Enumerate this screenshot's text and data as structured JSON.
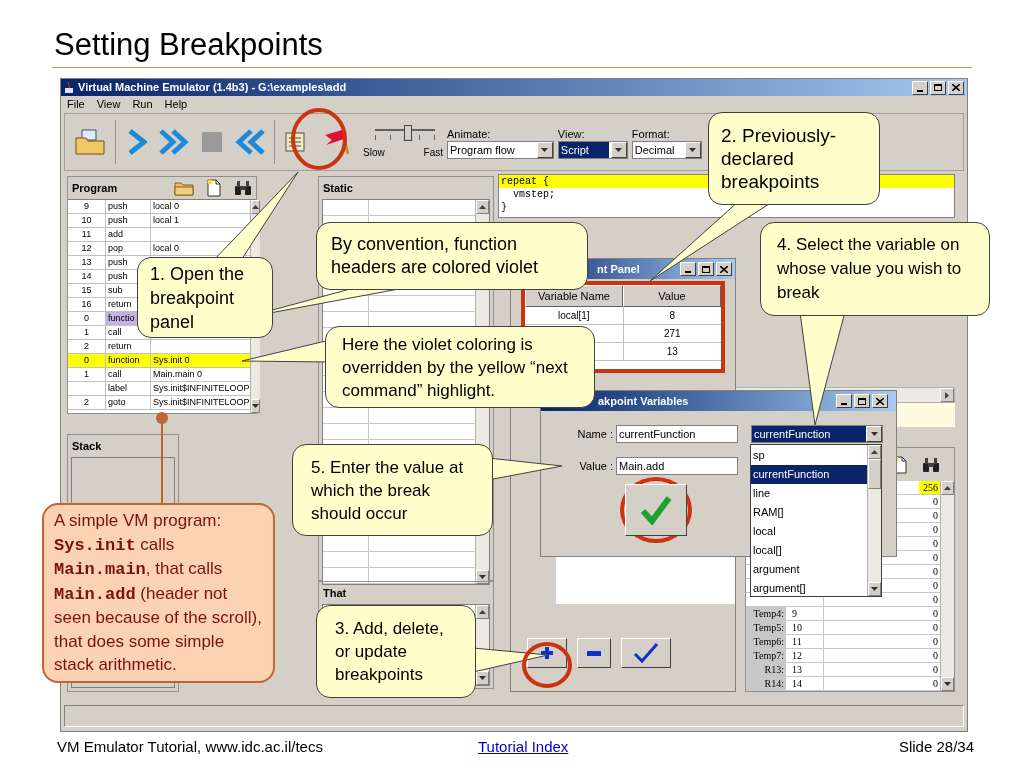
{
  "slide": {
    "title": "Setting Breakpoints",
    "footer_text": "VM Emulator Tutorial, www.idc.ac.il/tecs",
    "footer_link": "Tutorial Index",
    "slide_number": "Slide 28/34"
  },
  "window": {
    "title": "Virtual Machine Emulator (1.4b3) - G:\\examples\\add",
    "menu": [
      "File",
      "View",
      "Run",
      "Help"
    ],
    "toolbar": {
      "speed": {
        "slow": "Slow",
        "fast": "Fast",
        "level": 0.55
      },
      "dropdowns": [
        {
          "label": "Animate:",
          "value": "Program flow",
          "focused": false
        },
        {
          "label": "View:",
          "value": "Script",
          "focused": true
        },
        {
          "label": "Format:",
          "value": "Decimal",
          "focused": false
        }
      ]
    },
    "program": {
      "title": "Program",
      "rows": [
        {
          "num": "9",
          "command": "push",
          "arg": "local 0",
          "kind": "plain"
        },
        {
          "num": "10",
          "command": "push",
          "arg": "local 1",
          "kind": "plain"
        },
        {
          "num": "11",
          "command": "add",
          "kind": "plain"
        },
        {
          "num": "12",
          "command": "pop",
          "arg": "local 0",
          "kind": "plain"
        },
        {
          "num": "13",
          "command": "push",
          "kind": "plain"
        },
        {
          "num": "14",
          "command": "push",
          "kind": "plain"
        },
        {
          "num": "15",
          "command": "sub",
          "kind": "plain"
        },
        {
          "num": "16",
          "command": "return",
          "kind": "plain"
        },
        {
          "num": "0",
          "command": "functio",
          "kind": "function"
        },
        {
          "num": "1",
          "command": "call",
          "kind": "plain"
        },
        {
          "num": "2",
          "command": "return",
          "kind": "plain"
        },
        {
          "num": "0",
          "command": "function",
          "arg": "Sys.init 0",
          "kind": "current"
        },
        {
          "num": "1",
          "command": "call",
          "arg": "Main.main 0",
          "kind": "plain"
        },
        {
          "command": "label",
          "arg": "Sys.init$INFINITELOOP",
          "kind": "plain"
        },
        {
          "num": "2",
          "command": "goto",
          "arg": "Sys.init$INFINITELOOP",
          "kind": "plain"
        }
      ]
    },
    "stack": {
      "title": "Stack"
    },
    "static": {
      "title": "Static"
    },
    "that": {
      "title": "That"
    },
    "script": {
      "lines": [
        {
          "text": "repeat {",
          "current": true
        },
        {
          "text": "  vmstep;",
          "current": false
        },
        {
          "text": "}",
          "current": false
        }
      ]
    },
    "ram": {
      "rows": [
        {
          "value": "256",
          "current": true
        },
        {
          "value": "0",
          "current": false
        },
        {
          "value": "0",
          "current": false
        },
        {
          "value": "0",
          "current": false
        },
        {
          "value": "0",
          "current": false
        },
        {
          "value": "0",
          "current": false
        },
        {
          "value": "0",
          "current": false
        },
        {
          "value": "0",
          "current": false
        },
        {
          "value": "0",
          "current": false
        },
        {
          "label": "Temp4:",
          "address": "9",
          "value": "0",
          "current": false
        },
        {
          "label": "Temp5:",
          "address": "10",
          "value": "0",
          "current": false
        },
        {
          "label": "Temp6:",
          "address": "11",
          "value": "0",
          "current": false
        },
        {
          "label": "Temp7:",
          "address": "12",
          "value": "0",
          "current": false
        },
        {
          "label": "R13:",
          "address": "13",
          "value": "0",
          "current": false
        },
        {
          "label": "R14:",
          "address": "14",
          "value": "0",
          "current": false
        }
      ]
    }
  },
  "breakpoint_panel": {
    "title": "nt Panel",
    "columns": [
      "Variable Name",
      "Value"
    ],
    "rows": [
      {
        "name": "local[1]",
        "value": "8"
      },
      {
        "value": "271"
      },
      {
        "value": "13"
      }
    ]
  },
  "breakpoint_variables": {
    "title": "akpoint Variables",
    "name_label": "Name :",
    "name_value": "currentFunction",
    "value_label": "Value :",
    "value_value": "Main.add",
    "variable": "currentFunction",
    "options": [
      {
        "label": "sp",
        "selected": false
      },
      {
        "label": "currentFunction",
        "selected": true
      },
      {
        "label": "line",
        "selected": false
      },
      {
        "label": "RAM[]",
        "selected": false
      },
      {
        "label": "local",
        "selected": false
      },
      {
        "label": "local[]",
        "selected": false
      },
      {
        "label": "argument",
        "selected": false
      },
      {
        "label": "argument[]",
        "selected": false
      }
    ]
  },
  "callouts": [
    {
      "text": "2. Previously-declared breakpoints"
    },
    {
      "text": "By convention, function headers are colored violet"
    },
    {
      "text": "4. Select the variable on whose value you wish to break"
    },
    {
      "text": "1. Open the breakpoint panel"
    },
    {
      "text": "Here the violet coloring is overridden by the yellow “next command” highlight."
    },
    {
      "text": "5. Enter the value at which the break should occur"
    },
    {
      "text": "3. Add, delete, or update breakpoints"
    }
  ],
  "program_note": {
    "text": "A simple VM program: **Sys.init** calls **Main.main**, that calls **Main.add** (header not seen because of the scroll), that does some simple stack arithmetic."
  }
}
